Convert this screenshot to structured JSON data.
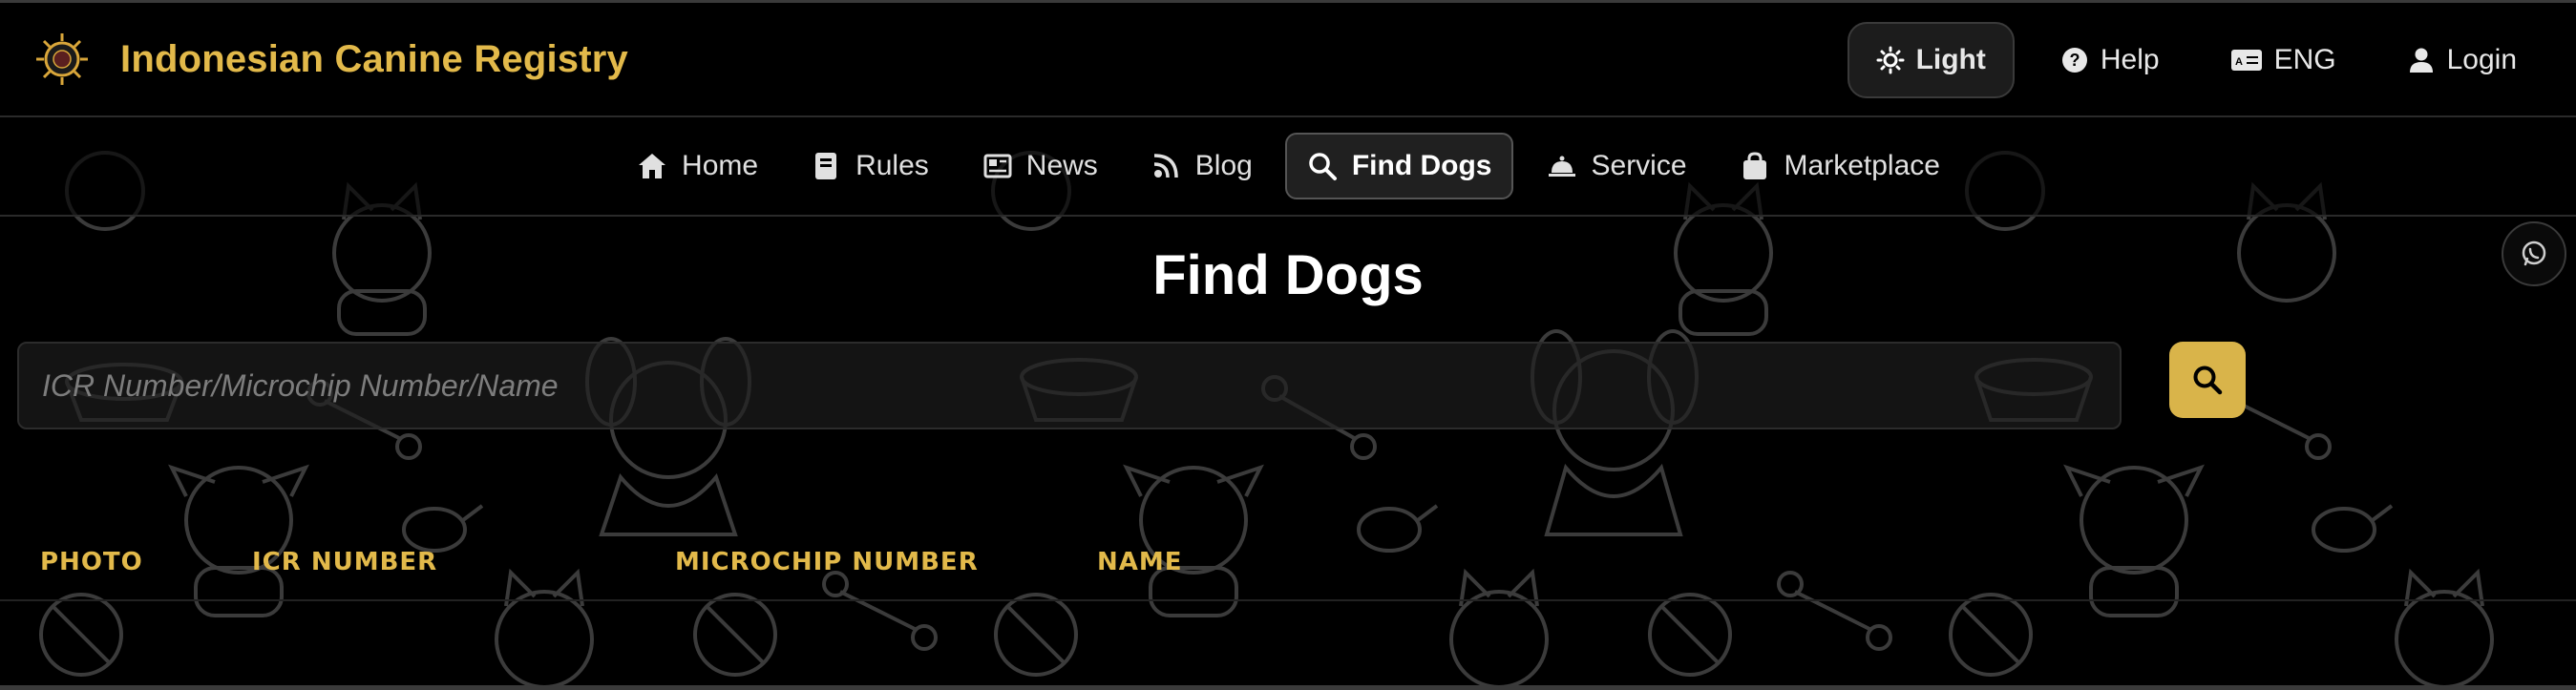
{
  "header": {
    "brand_name": "Indonesian Canine Registry",
    "theme_toggle_label": "Light",
    "help_label": "Help",
    "language_label": "ENG",
    "login_label": "Login"
  },
  "nav": {
    "items": [
      {
        "label": "Home",
        "icon": "home-icon"
      },
      {
        "label": "Rules",
        "icon": "book-icon"
      },
      {
        "label": "News",
        "icon": "newspaper-icon"
      },
      {
        "label": "Blog",
        "icon": "feed-icon"
      },
      {
        "label": "Find Dogs",
        "icon": "search-icon",
        "active": true
      },
      {
        "label": "Service",
        "icon": "bell-icon"
      },
      {
        "label": "Marketplace",
        "icon": "shopping-bag-icon"
      }
    ]
  },
  "main": {
    "title": "Find Dogs",
    "search_placeholder": "ICR Number/Microchip Number/Name",
    "columns": [
      "PHOTO",
      "ICR NUMBER",
      "MICROCHIP NUMBER",
      "NAME"
    ]
  },
  "colors": {
    "accent": "#e2b94a",
    "search_button": "#d9b44a",
    "background": "#000000"
  }
}
